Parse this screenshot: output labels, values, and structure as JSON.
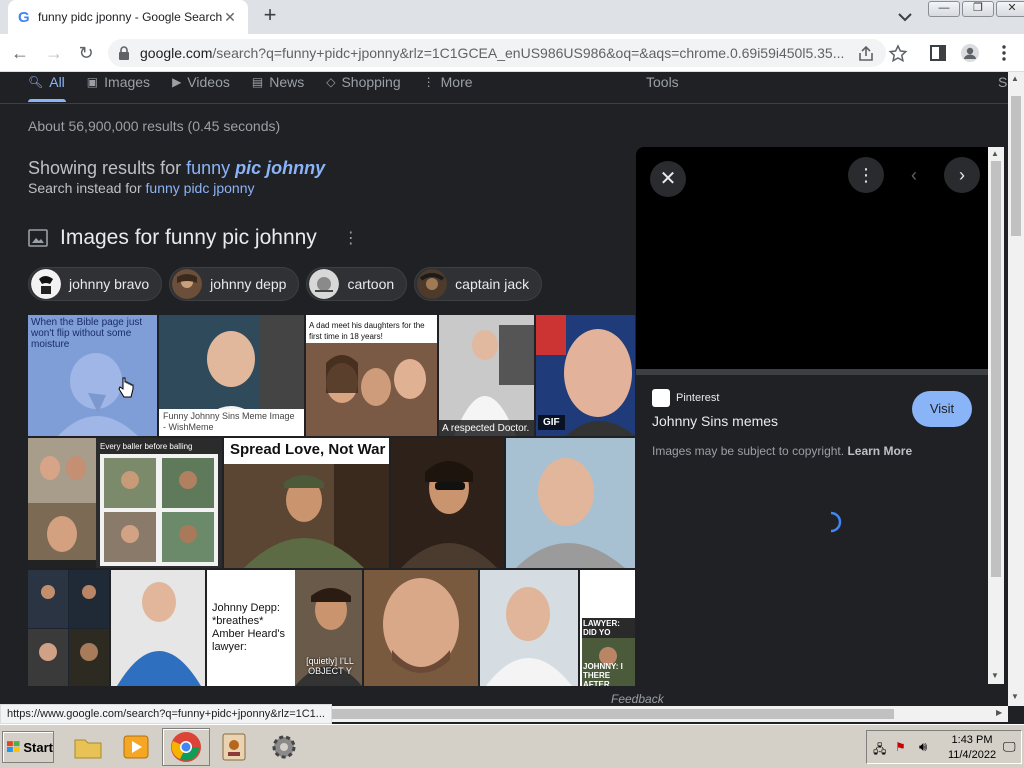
{
  "browser": {
    "tab_title": "funny pidc jponny - Google Search",
    "url_host": "google.com",
    "url_path": "/search?q=funny+pidc+jponny&rlz=1C1GCEA_enUS986US986&oq=&aqs=chrome.0.69i59i450l5.35...",
    "status_url": "https://www.google.com/search?q=funny+pidc+jponny&rlz=1C1..."
  },
  "nav": {
    "tabs": [
      {
        "label": "All",
        "icon": "search-icon"
      },
      {
        "label": "Images",
        "icon": "image-icon"
      },
      {
        "label": "Videos",
        "icon": "video-icon"
      },
      {
        "label": "News",
        "icon": "news-icon"
      },
      {
        "label": "Shopping",
        "icon": "tag-icon"
      },
      {
        "label": "More",
        "icon": "kebab-icon"
      }
    ],
    "tools": "Tools",
    "cutoff": "S"
  },
  "results": {
    "stats": "About 56,900,000 results (0.45 seconds)",
    "showing_prefix": "Showing results for",
    "showing_word1": "funny",
    "showing_rest": "pic johnny",
    "instead_prefix": "Search instead for",
    "instead_link": "funny pidc jponny"
  },
  "images_section": {
    "heading": "Images for funny pic johnny",
    "chips": [
      {
        "label": "johnny bravo"
      },
      {
        "label": "johnny depp"
      },
      {
        "label": "cartoon"
      },
      {
        "label": "captain jack"
      }
    ],
    "captions": {
      "bible": "When the Bible page just won't flip without some moisture",
      "wishmeme": "Funny Johnny Sins Meme Image - WishMeme",
      "dad": "A dad meet his daughters for the first time in 18 years!",
      "doctor": "A respected Doctor.",
      "gif": "GIF",
      "baller": "Every baller before balling",
      "spread": "Spread Love, Not War",
      "depp_text": "Johnny Depp: *breathes* Amber Heard's lawyer:",
      "quietly": "[quietly] I'LL OBJECT Y",
      "lawyer": "LAWYER: DID YO HAPPENED AFTE",
      "johnny_there": "JOHNNY: I THERE AFTER"
    }
  },
  "panel": {
    "source": "Pinterest",
    "title": "Johnny Sins memes",
    "visit": "Visit",
    "copyright": "Images may be subject to copyright.",
    "learn_more": "Learn More"
  },
  "footer": {
    "feedback": "Feedback"
  },
  "taskbar": {
    "start": "Start",
    "time": "1:43 PM",
    "date": "11/4/2022"
  }
}
